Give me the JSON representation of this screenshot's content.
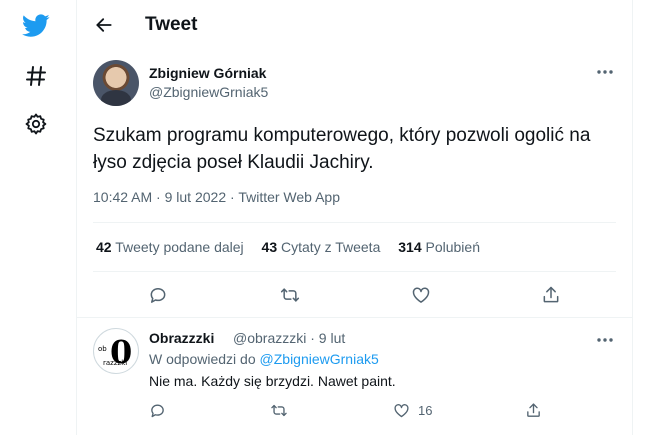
{
  "header": {
    "title": "Tweet"
  },
  "tweet": {
    "author_name": "Zbigniew Górniak",
    "author_handle": "@ZbigniewGrniak5",
    "text": "Szukam programu komputerowego, który pozwoli ogolić na łyso zdjęcia poseł Klaudii Jachiry.",
    "time": "10:42 AM",
    "date": "9 lut 2022",
    "client": "Twitter Web App",
    "separator": "·",
    "stats": {
      "retweets_count": "42",
      "retweets_label": "Tweety podane dalej",
      "quotes_count": "43",
      "quotes_label": "Cytaty z Tweeta",
      "likes_count": "314",
      "likes_label": "Polubień"
    }
  },
  "reply": {
    "author_name": "Obrazzzki",
    "author_handle": "@obrazzzki",
    "date": "9 lut",
    "separator": "·",
    "reply_to_prefix": "W odpowiedzi do",
    "reply_to_handle": "@ZbigniewGrniak5",
    "text": "Nie ma. Każdy się brzydzi. Nawet paint.",
    "like_count": "16",
    "avatar_text": {
      "main": "0",
      "left": "ob",
      "bottom": "razzzki"
    }
  },
  "icons": {
    "logo": "twitter-bird-icon",
    "explore": "hashtag-icon",
    "settings": "gear-icon",
    "back": "arrow-left-icon",
    "more": "more-horizontal-icon",
    "reply": "reply-icon",
    "retweet": "retweet-icon",
    "like": "heart-icon",
    "share": "share-icon"
  },
  "colors": {
    "brand": "#1d9bf0",
    "text": "#0f1419",
    "secondary": "#536471",
    "border": "#eff3f4"
  }
}
